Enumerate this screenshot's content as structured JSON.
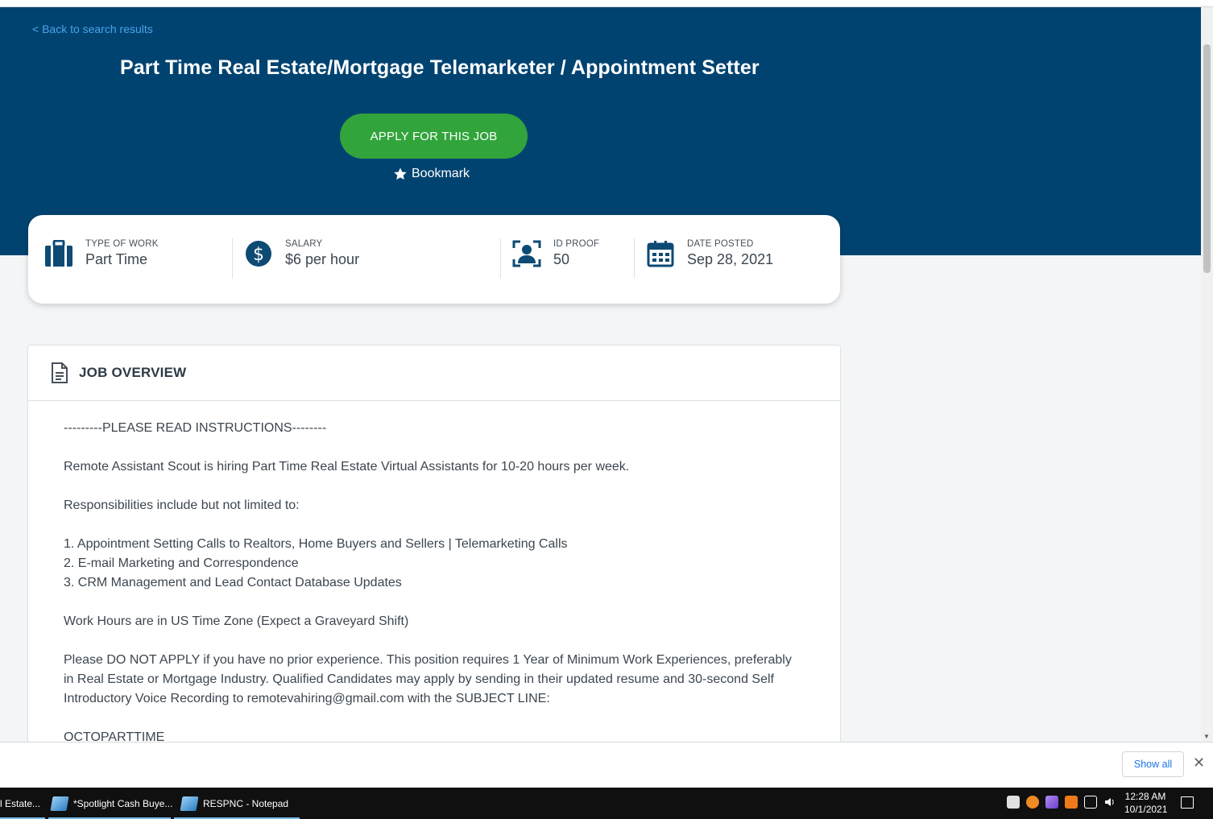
{
  "header": {
    "back_link": "< Back to search results",
    "title": "Part Time Real Estate/Mortgage Telemarketer / Appointment Setter",
    "apply_label": "APPLY FOR THIS JOB",
    "bookmark_label": "Bookmark"
  },
  "info": [
    {
      "label": "TYPE OF WORK",
      "value": "Part Time",
      "icon": "briefcase-icon"
    },
    {
      "label": "SALARY",
      "value": "$6 per hour",
      "icon": "dollar-icon"
    },
    {
      "label": "ID PROOF",
      "value": "50",
      "icon": "id-person-icon"
    },
    {
      "label": "DATE POSTED",
      "value": "Sep 28, 2021",
      "icon": "calendar-icon"
    }
  ],
  "overview": {
    "title": "JOB OVERVIEW",
    "lines": [
      "---------PLEASE READ INSTRUCTIONS--------",
      "Remote Assistant Scout is hiring Part Time Real Estate Virtual Assistants for 10-20 hours per week.",
      "Responsibilities include but not limited to:",
      "1. Appointment Setting Calls to Realtors, Home Buyers and Sellers | Telemarketing Calls",
      "2. E-mail Marketing and Correspondence",
      "3. CRM Management and Lead Contact Database Updates",
      "Work Hours are in US Time Zone (Expect a Graveyard Shift)",
      "Please DO NOT APPLY if you have no prior experience. This position requires 1 Year of Minimum Work Experiences, preferably in Real Estate or Mortgage Industry. Qualified Candidates may apply by sending in their updated resume and 30-second Self Introductory Voice Recording to remotevahiring@gmail.com with the SUBJECT LINE:",
      "OCTOPARTTIME"
    ]
  },
  "download_bar": {
    "show_all": "Show all",
    "close": "✕"
  },
  "taskbar": {
    "items": [
      "l Estate...",
      "*Spotlight Cash Buye...",
      "RESPNC - Notepad"
    ],
    "time": "12:28 AM",
    "date": "10/1/2021"
  },
  "colors": {
    "hero": "#004370",
    "apply": "#32a43c",
    "link": "#4aa3ea"
  }
}
